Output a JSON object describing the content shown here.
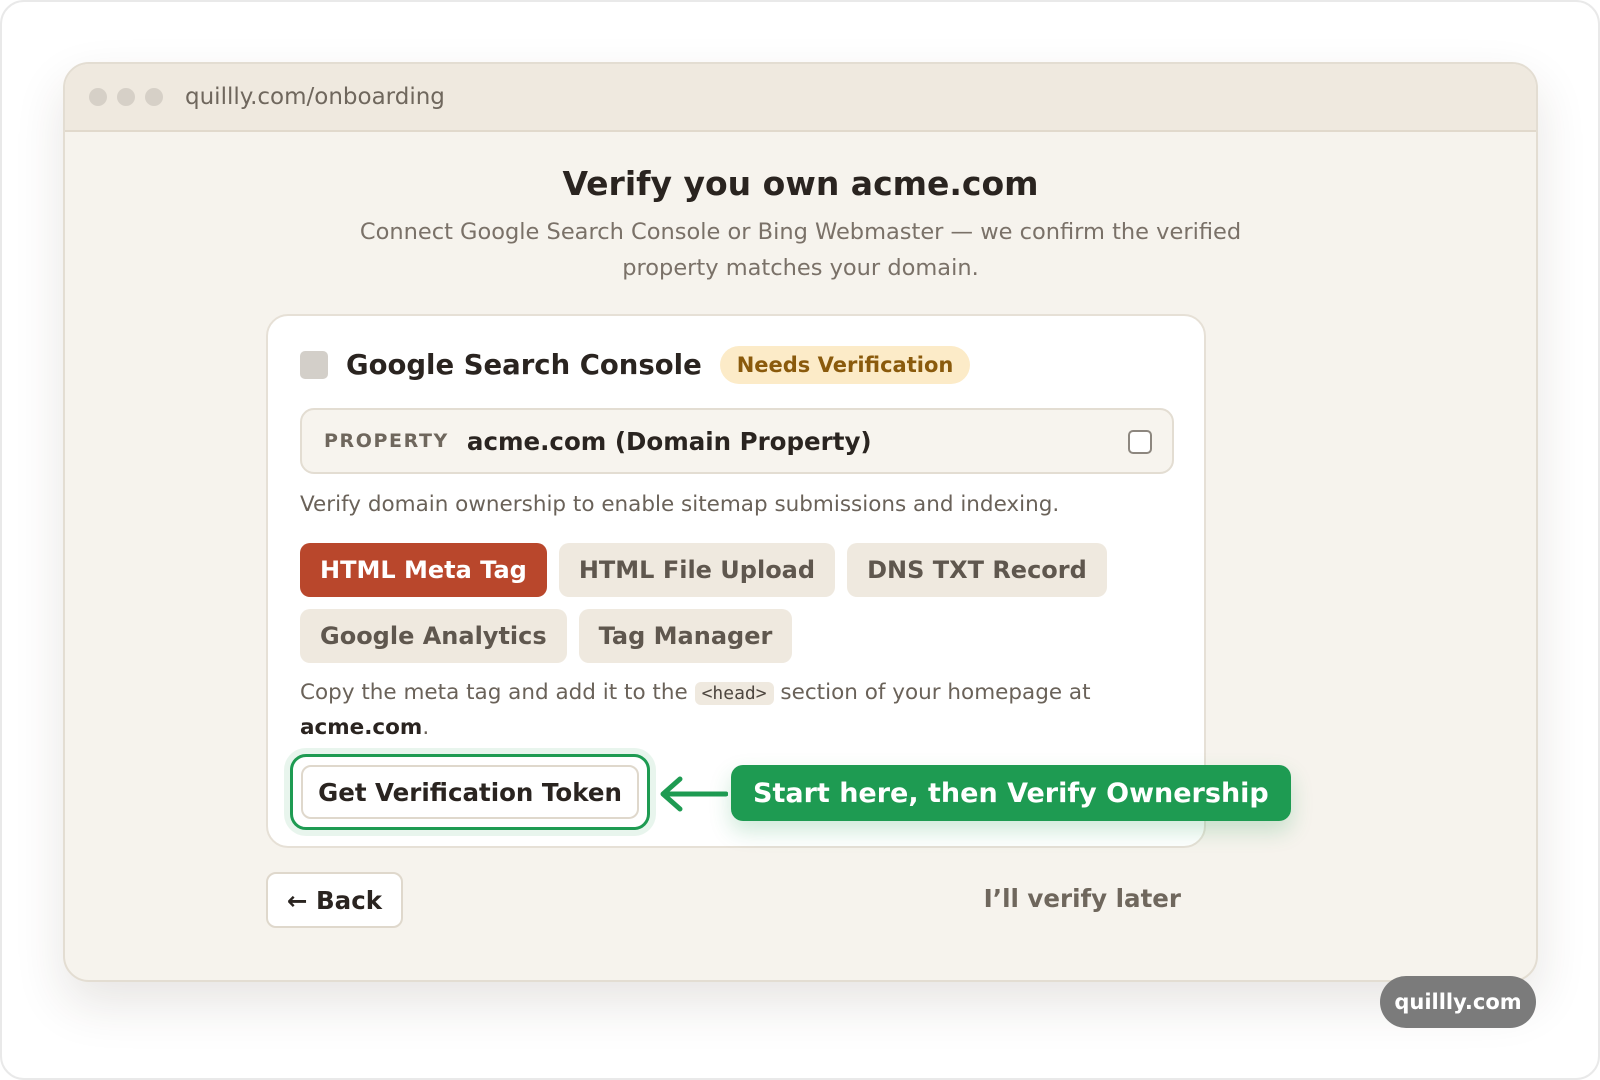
{
  "browser": {
    "url": "quillly.com/onboarding"
  },
  "page": {
    "title": "Verify you own acme.com",
    "subtitle": "Connect Google Search Console or Bing Webmaster — we confirm the verified property matches your domain."
  },
  "card": {
    "title": "Google Search Console",
    "badge": "Needs Verification",
    "property_label": "PROPERTY",
    "property_value": "acme.com (Domain Property)",
    "description": "Verify domain ownership to enable sitemap submissions and indexing.",
    "methods": [
      {
        "label": "HTML Meta Tag",
        "active": true
      },
      {
        "label": "HTML File Upload",
        "active": false
      },
      {
        "label": "DNS TXT Record",
        "active": false
      },
      {
        "label": "Google Analytics",
        "active": false
      },
      {
        "label": "Tag Manager",
        "active": false
      }
    ],
    "instructions_prefix": "Copy the meta tag and add it to the ",
    "instructions_code": "<head>",
    "instructions_suffix": " section of your homepage at ",
    "instructions_domain": "acme.com",
    "instructions_end": ".",
    "token_button": "Get Verification Token",
    "callout": "Start here, then Verify Ownership"
  },
  "footer": {
    "back": "← Back",
    "later": "I’ll verify later"
  },
  "brand": "quillly.com",
  "colors": {
    "accent": "#b9472c",
    "success": "#1e9b52",
    "badge_bg": "#fcebc8",
    "badge_text": "#8a5a0c"
  },
  "icons": {
    "site": "gsc-icon",
    "arrow": "arrow-left-icon"
  }
}
